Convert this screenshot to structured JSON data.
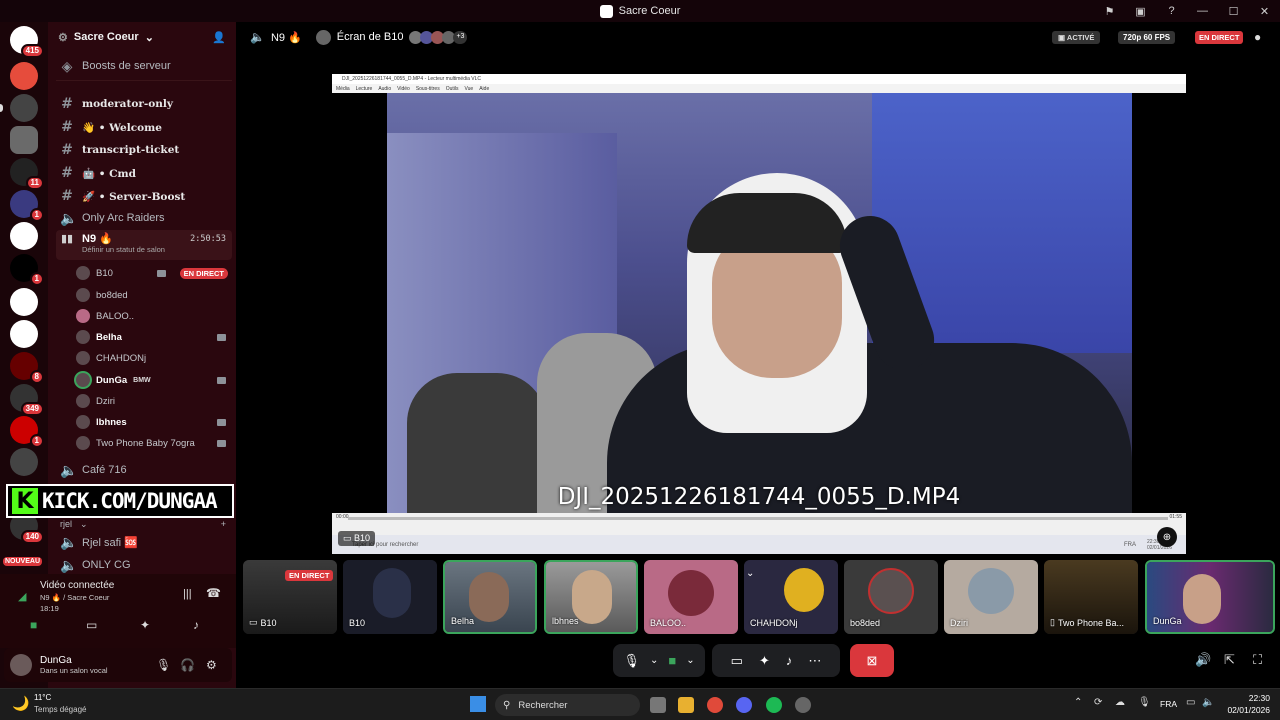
{
  "window": {
    "title": "Sacre Coeur"
  },
  "rail": {
    "badges": [
      "415",
      "11",
      "1",
      "1",
      "8",
      "349",
      "1",
      "140"
    ],
    "new_label": "NOUVEAU"
  },
  "server": {
    "name": "Sacre Coeur",
    "boosts": "Boosts de serveur"
  },
  "channels": [
    {
      "name": "moderator-only"
    },
    {
      "name": "👋 • Welcome"
    },
    {
      "name": "transcript-ticket"
    },
    {
      "name": "🤖 • Cmd"
    },
    {
      "name": "🚀 • Server-Boost"
    },
    {
      "name": "Only Arc Raiders"
    }
  ],
  "voice_channel": {
    "name": "N9 🔥",
    "timer": "2:50:53",
    "status_hint": "Définir un statut de salon",
    "live_label": "EN DIRECT",
    "members": [
      "B10",
      "bo8ded",
      "BALOO..",
      "Belha",
      "CHAHDONj",
      "DunGa",
      "Dziri",
      "lbhnes",
      "Two Phone Baby 7ogra"
    ],
    "dunga_tag": "BMW"
  },
  "other_channels": {
    "cafe": "Café 716",
    "category": "rjel",
    "rjel_safi": "Rjel safi 🆘",
    "only_cg": "ONLY CG"
  },
  "kick_banner": {
    "letter": "K",
    "text": "KICK.COM/DUNGAA"
  },
  "voice_panel": {
    "status": "Vidéo connectée",
    "location": "N9 🔥 / Sacre Coeur",
    "time": "18:19"
  },
  "user_panel": {
    "name": "DunGa",
    "status": "Dans un salon vocal"
  },
  "stage": {
    "channel": "N9 🔥",
    "screen_label": "Écran de B10",
    "extra_count": "+3",
    "active_label": "ACTIVÉ",
    "quality": "720p 60 FPS",
    "live_label": "EN DIRECT"
  },
  "vlc": {
    "title": "DJI_20251226181744_0055_D.MP4 - Lecteur multimédia VLC",
    "menu": [
      "Média",
      "Lecture",
      "Audio",
      "Vidéo",
      "Sous-titres",
      "Outils",
      "Vue",
      "Aide"
    ],
    "filename": "DJI_20251226181744_0055_D.MP4",
    "time_start": "00:00",
    "time_end": "01:55",
    "mini_search": "Taper ici pour rechercher",
    "mini_lang": "FRA",
    "mini_clock": "22:30",
    "mini_date": "02/01/2026"
  },
  "screen_owner": "B10",
  "tiles": [
    {
      "name": "B10",
      "live": "EN DIRECT",
      "color": "#2a2a2a"
    },
    {
      "name": "B10",
      "color": "#1a1c28"
    },
    {
      "name": "Belha",
      "color": "#4a5560"
    },
    {
      "name": "lbhnes",
      "color": "#6a6a6a"
    },
    {
      "name": "BALOO..",
      "color": "#b96a86"
    },
    {
      "name": "CHAHDONj",
      "color": "#2a2840"
    },
    {
      "name": "bo8ded",
      "color": "#3a3a3a"
    },
    {
      "name": "Dziri",
      "color": "#b5aaa0"
    },
    {
      "name": "Two Phone Ba...",
      "color": "#2a2218"
    },
    {
      "name": "DunGa",
      "color": "#3a2a50"
    }
  ],
  "taskbar": {
    "weather_temp": "11°C",
    "weather_desc": "Temps dégagé",
    "search": "Rechercher",
    "lang": "FRA",
    "clock": "22:30",
    "date": "02/01/2026"
  },
  "colors": {
    "live": "#da373c",
    "active_green": "#3ba55c",
    "kick": "#53fc18"
  }
}
